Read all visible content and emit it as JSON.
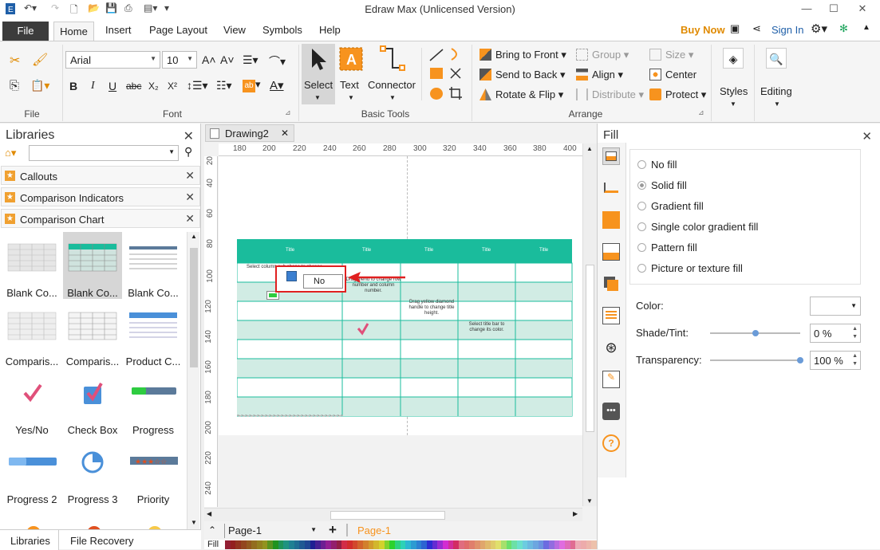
{
  "app": {
    "title": "Edraw Max (Unlicensed Version)"
  },
  "menu": {
    "file": "File",
    "tabs": [
      "Home",
      "Insert",
      "Page Layout",
      "View",
      "Symbols",
      "Help"
    ],
    "buy_now": "Buy Now",
    "sign_in": "Sign In"
  },
  "ribbon": {
    "groups": {
      "file": "File",
      "font": "Font",
      "basic_tools": "Basic Tools",
      "arrange": "Arrange"
    },
    "font_name": "Arial",
    "font_size": "10",
    "tools": {
      "select": "Select",
      "text": "Text",
      "connector": "Connector"
    },
    "arrange": {
      "bring_front": "Bring to Front",
      "send_back": "Send to Back",
      "rotate_flip": "Rotate & Flip",
      "group": "Group",
      "align": "Align",
      "distribute": "Distribute",
      "size": "Size",
      "center": "Center",
      "protect": "Protect"
    },
    "styles": "Styles",
    "editing": "Editing"
  },
  "libraries": {
    "title": "Libraries",
    "search_value": "",
    "categories": [
      "Callouts",
      "Comparison Indicators",
      "Comparison Chart"
    ],
    "shapes": [
      "Blank Co...",
      "Blank Co...",
      "Blank Co...",
      "Comparis...",
      "Comparis...",
      "Product C...",
      "Yes/No",
      "Check Box",
      "Progress",
      "Progress 2",
      "Progress 3",
      "Priority"
    ],
    "bottom_tabs": [
      "Libraries",
      "File Recovery"
    ]
  },
  "canvas": {
    "doc_tab": "Drawing2",
    "ruler_h": [
      "180",
      "200",
      "220",
      "240",
      "260",
      "280",
      "300",
      "320",
      "340",
      "360",
      "380",
      "400"
    ],
    "ruler_v": [
      "20",
      "40",
      "60",
      "80",
      "100",
      "120",
      "140",
      "160",
      "180",
      "200",
      "220",
      "240"
    ],
    "table_headers": [
      "Title",
      "Title",
      "Title",
      "Title",
      "Title"
    ],
    "notes": {
      "n1": "Select column sub shape to change",
      "n2": "Drag menu to change row number and column number.",
      "n3": "Drag yellow diamond handle to change title height.",
      "n4": "Select title bar to change its color."
    },
    "popup_value": "No",
    "page_tab": "Page-1",
    "active_page": "Page-1",
    "fill_label": "Fill"
  },
  "fill": {
    "title": "Fill",
    "options": [
      "No fill",
      "Solid fill",
      "Gradient fill",
      "Single color gradient fill",
      "Pattern fill",
      "Picture or texture fill"
    ],
    "selected": "Solid fill",
    "color_label": "Color:",
    "shade_label": "Shade/Tint:",
    "shade_value": "0 %",
    "transparency_label": "Transparency:",
    "transparency_value": "100 %",
    "shade_level": 0.5,
    "transparency_level": 1.0
  },
  "colors": {
    "accent": "#2e75b6",
    "teal": "#1abc9c",
    "teal_light": "#d1ece4",
    "red": "#e02020",
    "orange": "#f7931e"
  }
}
